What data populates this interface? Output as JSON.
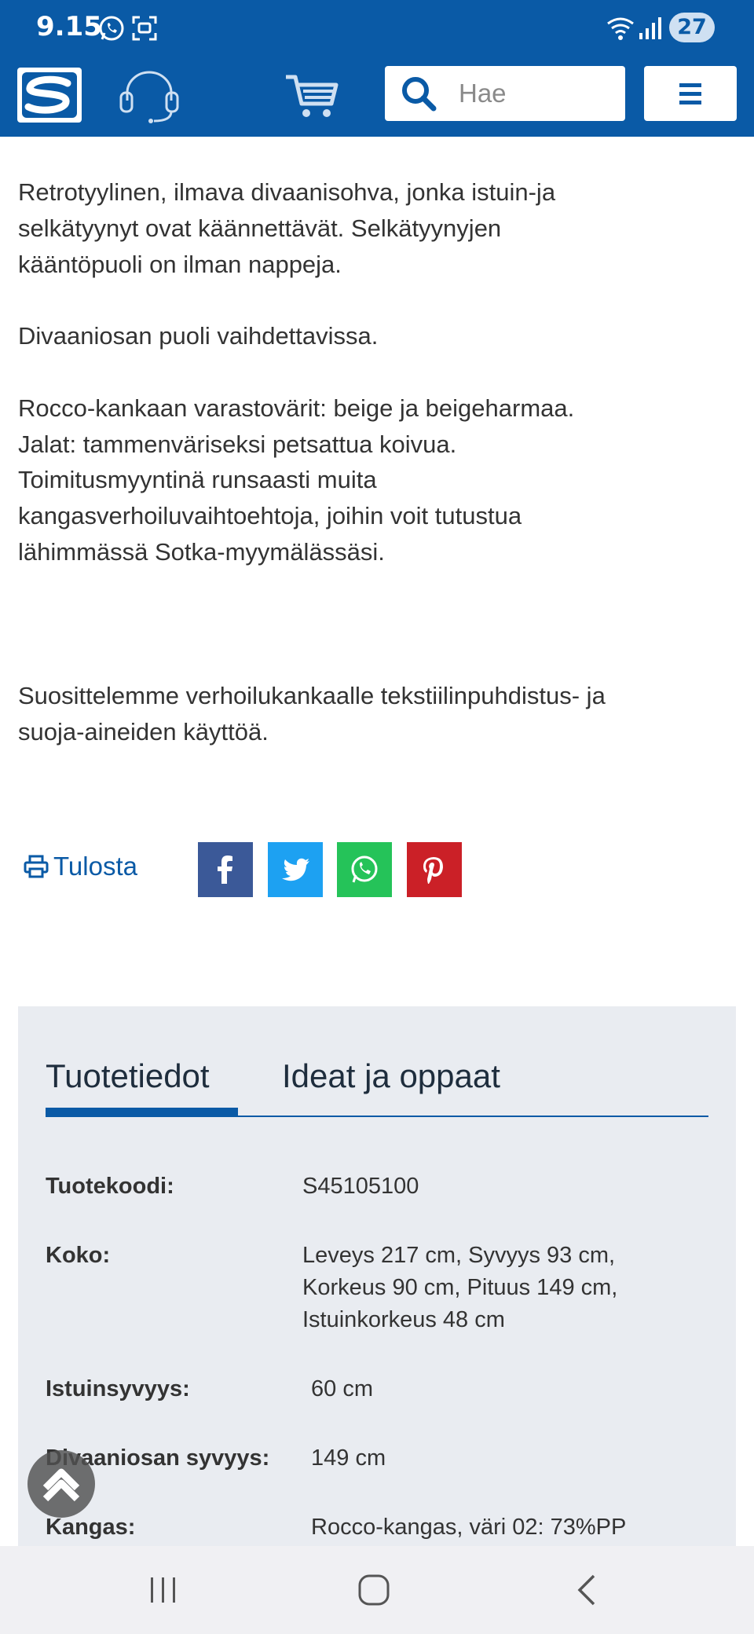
{
  "status_bar": {
    "time": "9.15",
    "battery": "27"
  },
  "header": {
    "search_placeholder": "Hae"
  },
  "description": [
    "Retrotyylinen, ilmava divaanisohva, jonka istuin-ja",
    "selkätyynyt ovat käännettävät. Selkätyynyjen",
    "kääntöpuoli on ilman nappeja.",
    "Divaaniosan puoli vaihdettavissa.",
    "Rocco-kankaan varastovärit: beige ja beigeharmaa.",
    "Jalat: tammenväriseksi petsattua koivua.",
    "Toimitusmyyntinä runsaasti muita",
    "kangasverhoiluvaihtoehtoja, joihin voit tutustua",
    "lähimmässä Sotka-myymälässäsi.",
    "Suosittelemme verhoilukankaalle tekstiilinpuhdistus- ja",
    "suoja-aineiden käyttöä."
  ],
  "share": {
    "print_label": "Tulosta"
  },
  "colors": {
    "brand": "#0a5aa6",
    "facebook": "#3b5998",
    "twitter": "#1da1f2",
    "whatsapp": "#25c359",
    "pinterest": "#cb2027"
  },
  "tabs": [
    {
      "label": "Tuotetiedot",
      "active": true
    },
    {
      "label": "Ideat ja oppaat",
      "active": false
    }
  ],
  "specs": [
    {
      "key": "Tuotekoodi:",
      "value": [
        "S45105100"
      ]
    },
    {
      "key": "Koko:",
      "value": [
        "Leveys 217 cm, Syvyys 93 cm,",
        "Korkeus 90 cm, Pituus 149 cm,",
        "Istuinkorkeus 48 cm"
      ]
    },
    {
      "key": "Istuinsyvyys:",
      "value": [
        "60 cm"
      ]
    },
    {
      "key": "Divaaniosan syvyys:",
      "value": [
        "149 cm"
      ]
    },
    {
      "key": "Kangas:",
      "value": [
        "Rocco-kangas, väri 02: 73%PP"
      ]
    }
  ]
}
